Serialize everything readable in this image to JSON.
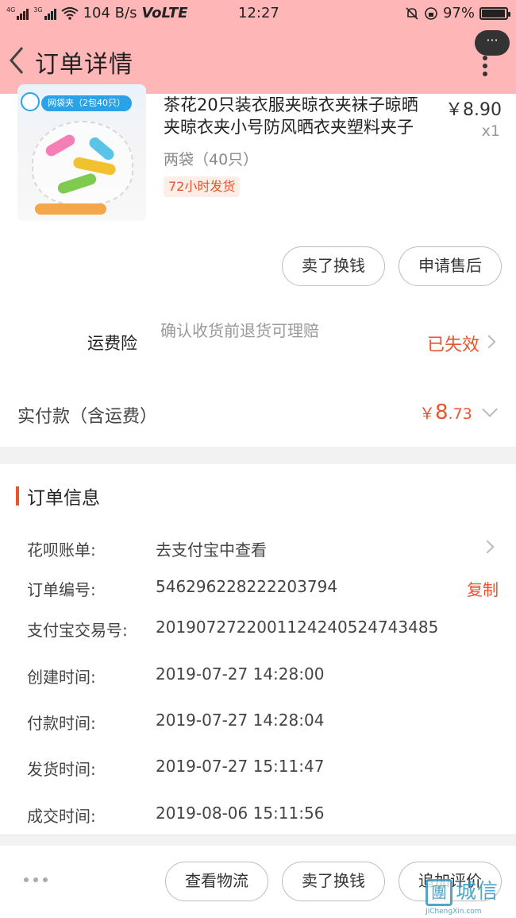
{
  "status_bar": {
    "net_4g": "4G",
    "net_3g": "3G",
    "speed": "104 B/s",
    "volte": "VoLTE",
    "time": "12:27",
    "battery": "97%",
    "battery_level": 0.97
  },
  "header": {
    "title": "订单详情",
    "bubble_dots": "···"
  },
  "product": {
    "image_tag": "网袋夹（2包40只）",
    "title": "茶花20只装衣服夹晾衣夹袜子晾晒夹晾衣夹小号防风晒衣夹塑料夹子",
    "price": "￥8.90",
    "quantity": "x1",
    "spec": "两袋（40只）",
    "shipping_badge": "72小时发货"
  },
  "item_actions": {
    "sell_label": "卖了换钱",
    "after_sale_label": "申请售后"
  },
  "insurance": {
    "label": "运费险",
    "description": "确认收货前退货可理赔",
    "status": "已失效"
  },
  "payment": {
    "label": "实付款（含运费）",
    "currency": "￥",
    "amount_int": "8",
    "amount_dec": ".73"
  },
  "order_info": {
    "title": "订单信息",
    "rows": [
      {
        "key": "花呗账单:",
        "value": "去支付宝中查看",
        "action": ""
      },
      {
        "key": "订单编号:",
        "value": "546296228222203794",
        "action": "复制"
      },
      {
        "key": "支付宝交易号:",
        "value": "2019072722001124240524743485",
        "action": ""
      },
      {
        "key": "创建时间:",
        "value": "2019-07-27 14:28:00",
        "action": ""
      },
      {
        "key": "付款时间:",
        "value": "2019-07-27 14:28:04",
        "action": ""
      },
      {
        "key": "发货时间:",
        "value": "2019-07-27 15:11:47",
        "action": ""
      },
      {
        "key": "成交时间:",
        "value": "2019-08-06 15:11:56",
        "action": ""
      }
    ]
  },
  "bottom_bar": {
    "logistics_label": "查看物流",
    "sell_label": "卖了换钱",
    "review_label": "追加评价"
  },
  "watermark": {
    "logo_char": "團",
    "name": "城信",
    "url": "JiChengXin.com"
  },
  "colors": {
    "header_bg": "#ffb6b6",
    "accent": "#e8542c",
    "band": "#f2f2f2"
  }
}
